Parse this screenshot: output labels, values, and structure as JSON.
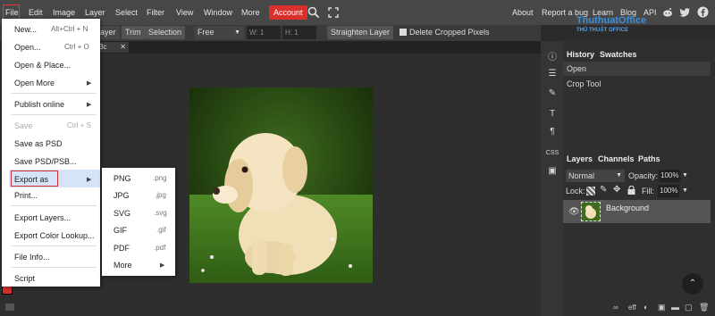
{
  "menubar": {
    "items": [
      "File",
      "Edit",
      "Image",
      "Layer",
      "Select",
      "Filter",
      "View",
      "Window",
      "More"
    ],
    "account": "Account",
    "right": [
      "About",
      "Report a bug",
      "Learn",
      "Blog",
      "API"
    ]
  },
  "watermark": {
    "line1": "ThuthuatOffice",
    "line2": "THỦ THUẬT OFFICE"
  },
  "options": {
    "layer": "ayer",
    "trim": "Trim",
    "selection": "Selection",
    "free": "Free",
    "w_label": "W:",
    "w_value": "1",
    "h_label": "H:",
    "h_value": "1",
    "straighten": "Straighten Layer",
    "delete_cropped": "Delete Cropped Pixels",
    "tab": "3c"
  },
  "file_menu": {
    "new": "New...",
    "new_sc": "Alt+Ctrl + N",
    "open": "Open...",
    "open_sc": "Ctrl + O",
    "open_place": "Open & Place...",
    "open_more": "Open More",
    "publish": "Publish online",
    "save": "Save",
    "save_sc": "Ctrl + S",
    "save_psd": "Save as PSD",
    "save_psd_psb": "Save PSD/PSB...",
    "export_as": "Export as",
    "print": "Print...",
    "export_layers": "Export Layers...",
    "export_color": "Export Color Lookup...",
    "file_info": "File Info...",
    "script": "Script"
  },
  "export_submenu": [
    {
      "label": "PNG",
      "ext": ".png"
    },
    {
      "label": "JPG",
      "ext": ".jpg"
    },
    {
      "label": "SVG",
      "ext": ".svg"
    },
    {
      "label": "GIF",
      "ext": ".gif"
    },
    {
      "label": "PDF",
      "ext": ".pdf"
    },
    {
      "label": "More",
      "ext": ""
    }
  ],
  "history": {
    "tabs": [
      "History",
      "Swatches"
    ],
    "items": [
      "Open",
      "Crop Tool"
    ]
  },
  "layers": {
    "tabs": [
      "Layers",
      "Channels",
      "Paths"
    ],
    "blend": "Normal",
    "opacity_label": "Opacity:",
    "opacity_value": "100%",
    "lock_label": "Lock:",
    "fill_label": "Fill:",
    "fill_value": "100%",
    "layer_name": "Background"
  },
  "toolcol": {
    "css_label": "CSS"
  },
  "colors": {
    "accent": "#d9302e",
    "menubar": "#474747",
    "panel": "#2f2f2f"
  }
}
